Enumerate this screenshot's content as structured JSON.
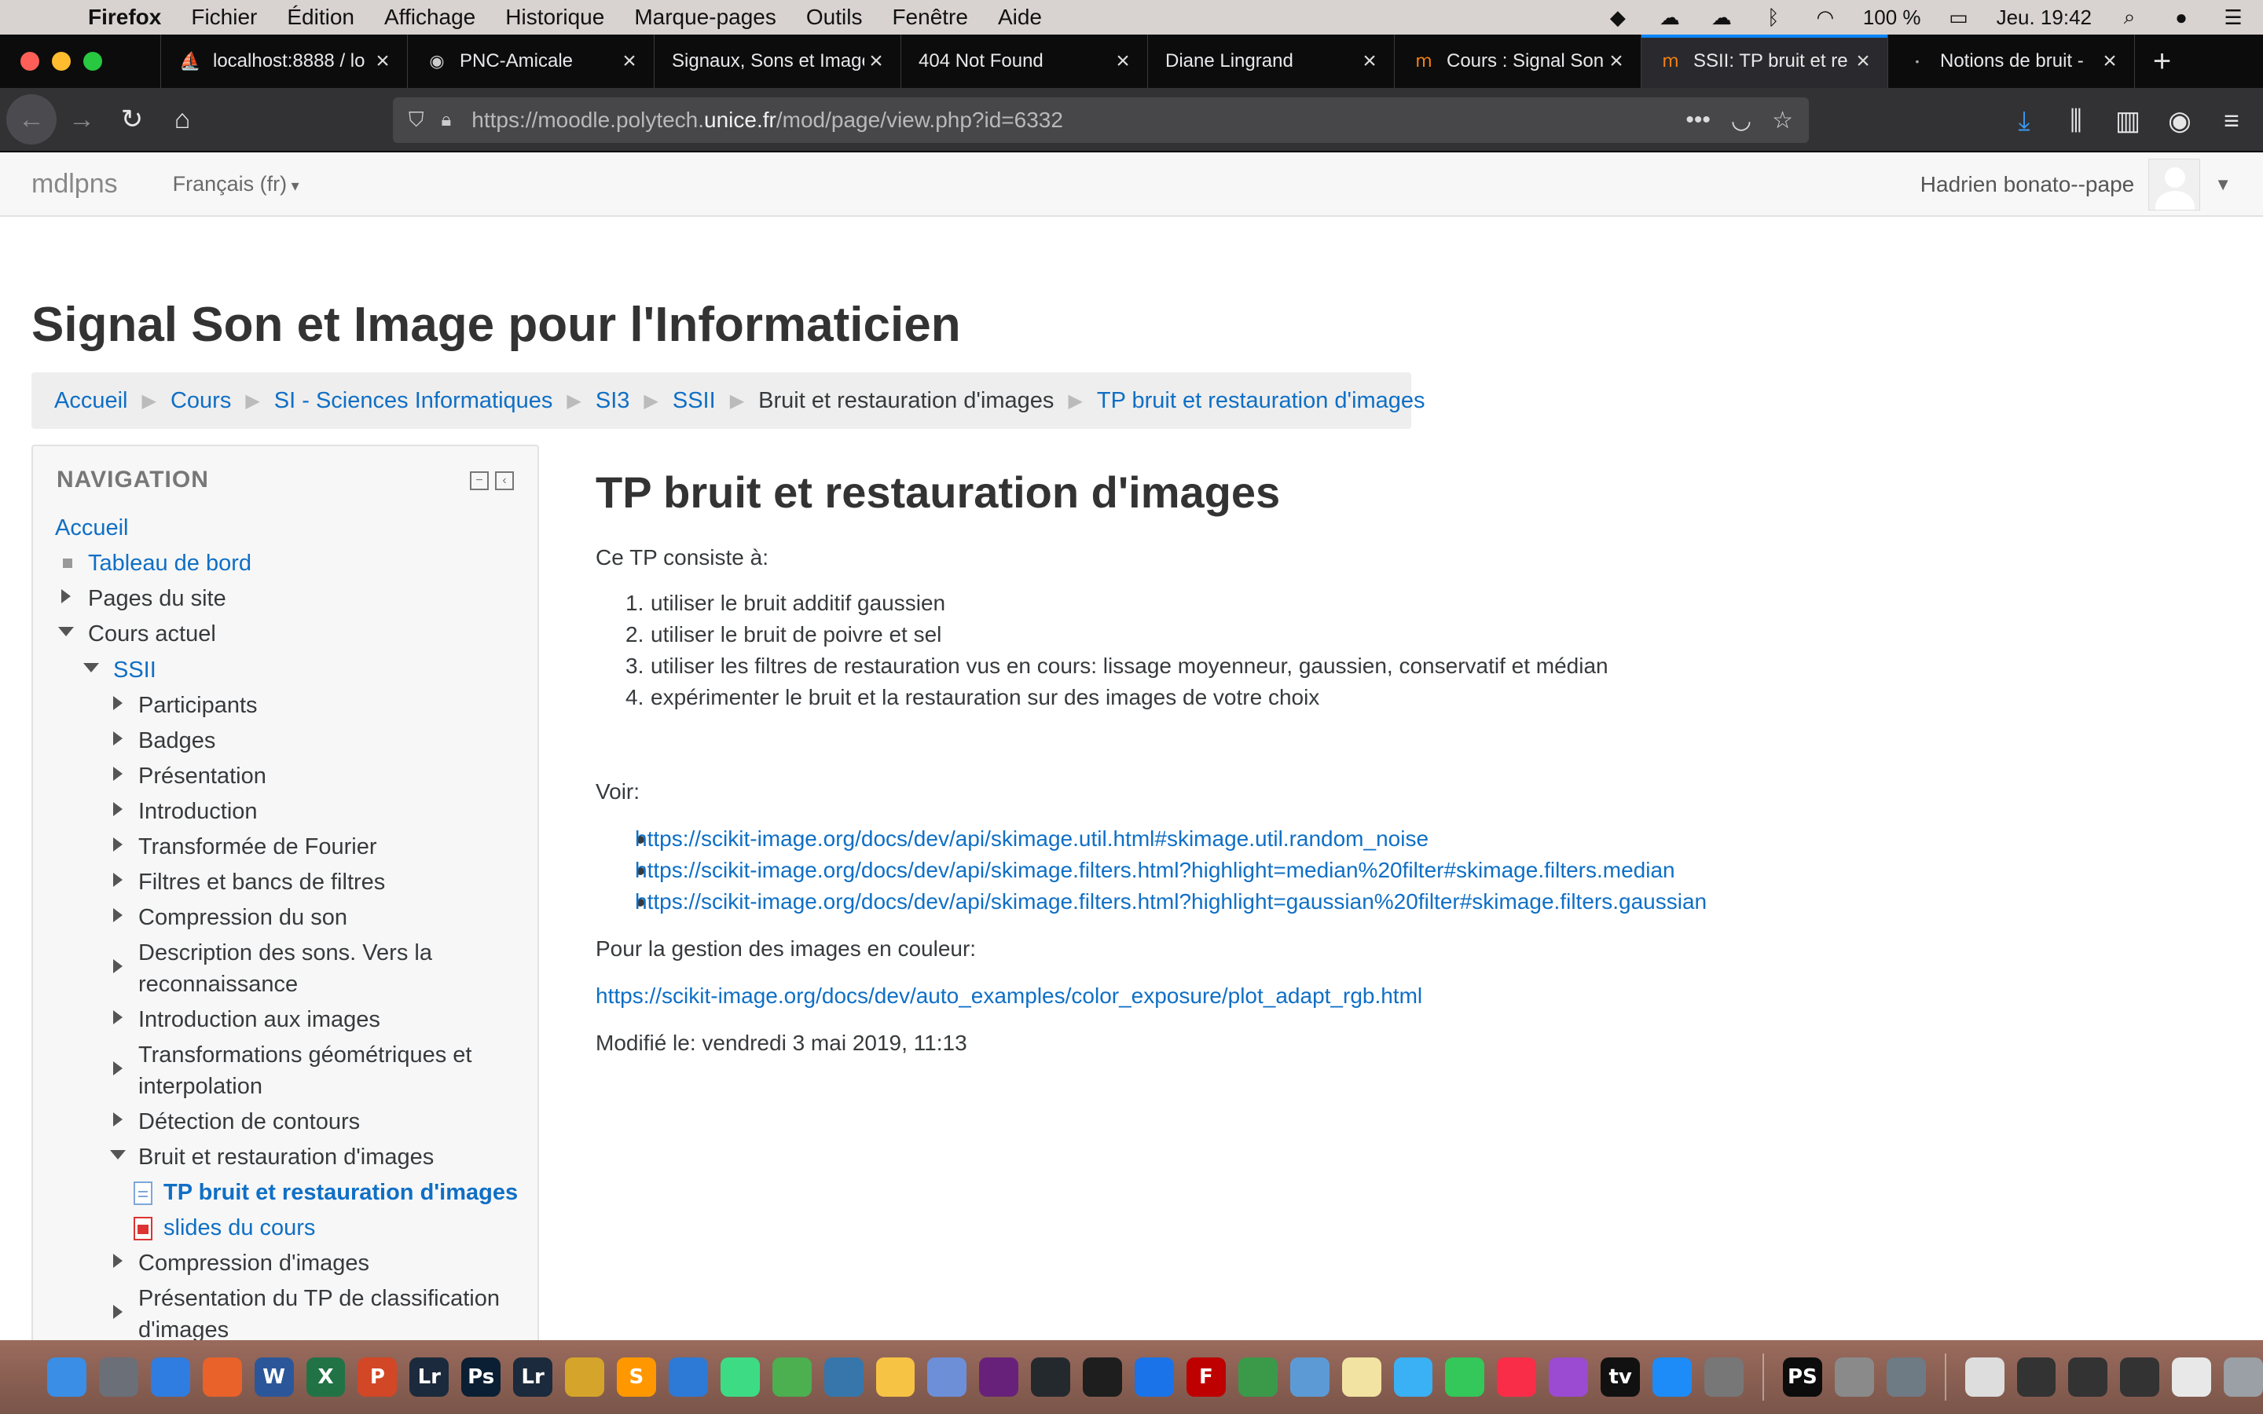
{
  "menubar": {
    "app": "Firefox",
    "items": [
      "Fichier",
      "Édition",
      "Affichage",
      "Historique",
      "Marque-pages",
      "Outils",
      "Fenêtre",
      "Aide"
    ],
    "battery": "100 %",
    "clock": "Jeu. 19:42"
  },
  "tabs": [
    {
      "title": "localhost:8888 / lo",
      "icon": "phpmyadmin-icon"
    },
    {
      "title": "PNC-Amicale",
      "icon": "site-icon"
    },
    {
      "title": "Signaux, Sons et Image",
      "icon": "none"
    },
    {
      "title": "404 Not Found",
      "icon": "none"
    },
    {
      "title": "Diane Lingrand",
      "icon": "none"
    },
    {
      "title": "Cours : Signal Son",
      "icon": "moodle-icon"
    },
    {
      "title": "SSII: TP bruit et re",
      "icon": "moodle-icon"
    },
    {
      "title": "Notions de bruit -",
      "icon": "loading-icon"
    }
  ],
  "url": {
    "prefix": "https://moodle.polytech.",
    "domain": "unice.fr",
    "path": "/mod/page/view.php?id=6332"
  },
  "moodle": {
    "brand": "mdlpns",
    "language": "Français (fr)",
    "user": "Hadrien bonato--pape"
  },
  "page_title": "Signal Son et Image pour l'Informaticien",
  "breadcrumb": [
    "Accueil",
    "Cours",
    "SI - Sciences Informatiques",
    "SI3",
    "SSII",
    "Bruit et restauration d'images",
    "TP bruit et restauration d'images"
  ],
  "navigation": {
    "heading": "NAVIGATION",
    "home": "Accueil",
    "dashboard": "Tableau de bord",
    "site_pages": "Pages du site",
    "current_course": "Cours actuel",
    "course": "SSII",
    "sections": [
      "Participants",
      "Badges",
      "Présentation",
      "Introduction",
      "Transformée de Fourier",
      "Filtres et bancs de filtres",
      "Compression du son",
      "Description des sons. Vers la",
      "reconnaissance",
      "Introduction aux images",
      "Transformations géométriques et",
      "interpolation",
      "Détection de contours",
      "Bruit et restauration d'images",
      "Compression d'images",
      "Présentation du TP de classification",
      "d'images"
    ],
    "current_activity": "TP bruit et restauration d'images",
    "slides": "slides du cours"
  },
  "content": {
    "heading": "TP bruit et restauration d'images",
    "intro": "Ce TP consiste à:",
    "list": [
      "utiliser le bruit additif gaussien",
      " utiliser le bruit de poivre et sel",
      "utiliser les filtres de restauration vus en cours: lissage moyenneur, gaussien, conservatif et médian",
      "expérimenter le bruit et la restauration sur des images de votre choix"
    ],
    "see": "Voir:",
    "links": [
      "https://scikit-image.org/docs/dev/api/skimage.util.html#skimage.util.random_noise",
      "https://scikit-image.org/docs/dev/api/skimage.filters.html?highlight=median%20filter#skimage.filters.median",
      "https://scikit-image.org/docs/dev/api/skimage.filters.html?highlight=gaussian%20filter#skimage.filters.gaussian"
    ],
    "color_note": "Pour la gestion des images en couleur:",
    "color_link": "https://scikit-image.org/docs/dev/auto_examples/color_exposure/plot_adapt_rgb.html",
    "modified": "Modifié le: vendredi 3 mai 2019, 11:13"
  },
  "dock": [
    {
      "label": "",
      "icon": "finder-icon",
      "color": "#3a8ee6"
    },
    {
      "label": "",
      "icon": "launchpad-icon",
      "color": "#6b6f78"
    },
    {
      "label": "",
      "icon": "safari-icon",
      "color": "#2f7de1"
    },
    {
      "label": "",
      "icon": "firefox-icon",
      "color": "#e8622a"
    },
    {
      "label": "W",
      "icon": "word-icon",
      "color": "#2b579a"
    },
    {
      "label": "X",
      "icon": "excel-icon",
      "color": "#217346"
    },
    {
      "label": "P",
      "icon": "powerpoint-icon",
      "color": "#d24726"
    },
    {
      "label": "Lr",
      "icon": "lightroom-classic-icon",
      "color": "#1b2a3c"
    },
    {
      "label": "Ps",
      "icon": "photoshop-icon",
      "color": "#0a1f33"
    },
    {
      "label": "Lr",
      "icon": "lightroom-icon",
      "color": "#1b2a3c"
    },
    {
      "label": "",
      "icon": "app-icon",
      "color": "#d4a52a"
    },
    {
      "label": "S",
      "icon": "sublime-icon",
      "color": "#ff9800"
    },
    {
      "label": "",
      "icon": "xcode-icon",
      "color": "#2d7ad6"
    },
    {
      "label": "",
      "icon": "android-studio-icon",
      "color": "#3ddc84"
    },
    {
      "label": "",
      "icon": "spinner-icon",
      "color": "#4caf50"
    },
    {
      "label": "",
      "icon": "python-icon",
      "color": "#3776ab"
    },
    {
      "label": "",
      "icon": "python-launcher-icon",
      "color": "#f6c344"
    },
    {
      "label": "",
      "icon": "notes-icon",
      "color": "#6d8fd8"
    },
    {
      "label": "",
      "icon": "visual-studio-icon",
      "color": "#68217a"
    },
    {
      "label": "",
      "icon": "github-icon",
      "color": "#24292e"
    },
    {
      "label": "",
      "icon": "terminal-icon",
      "color": "#1e1e1e"
    },
    {
      "label": "",
      "icon": "sketch-icon",
      "color": "#1a73e8"
    },
    {
      "label": "F",
      "icon": "filezilla-icon",
      "color": "#bf0000"
    },
    {
      "label": "",
      "icon": "globe-icon",
      "color": "#3a9a4a"
    },
    {
      "label": "",
      "icon": "preview-icon",
      "color": "#5c9ad6"
    },
    {
      "label": "",
      "icon": "textedit-icon",
      "color": "#f2e3a2"
    },
    {
      "label": "",
      "icon": "messages-icon",
      "color": "#3ab0f5"
    },
    {
      "label": "",
      "icon": "facetime-icon",
      "color": "#34c759"
    },
    {
      "label": "",
      "icon": "music-icon",
      "color": "#fa2d48"
    },
    {
      "label": "",
      "icon": "podcasts-icon",
      "color": "#9b4bd1"
    },
    {
      "label": "tv",
      "icon": "tv-icon",
      "color": "#111111"
    },
    {
      "label": "",
      "icon": "app-store-icon",
      "color": "#1d8cf8"
    },
    {
      "label": "",
      "icon": "system-preferences-icon",
      "color": "#777777"
    },
    {
      "label": "PS",
      "icon": "phpstorm-icon",
      "color": "#0c0c0c"
    },
    {
      "label": "",
      "icon": "screenshot-icon",
      "color": "#8a8a8a"
    },
    {
      "label": "",
      "icon": "app-icon",
      "color": "#6e7b85"
    },
    {
      "label": "",
      "icon": "document-icon",
      "color": "#dddddd"
    },
    {
      "label": "",
      "icon": "window-icon",
      "color": "#333333"
    },
    {
      "label": "",
      "icon": "window-icon",
      "color": "#333333"
    },
    {
      "label": "",
      "icon": "window-icon",
      "color": "#333333"
    },
    {
      "label": "",
      "icon": "window-icon",
      "color": "#e8e8e8"
    },
    {
      "label": "",
      "icon": "trash-icon",
      "color": "#9aa0a6"
    }
  ]
}
